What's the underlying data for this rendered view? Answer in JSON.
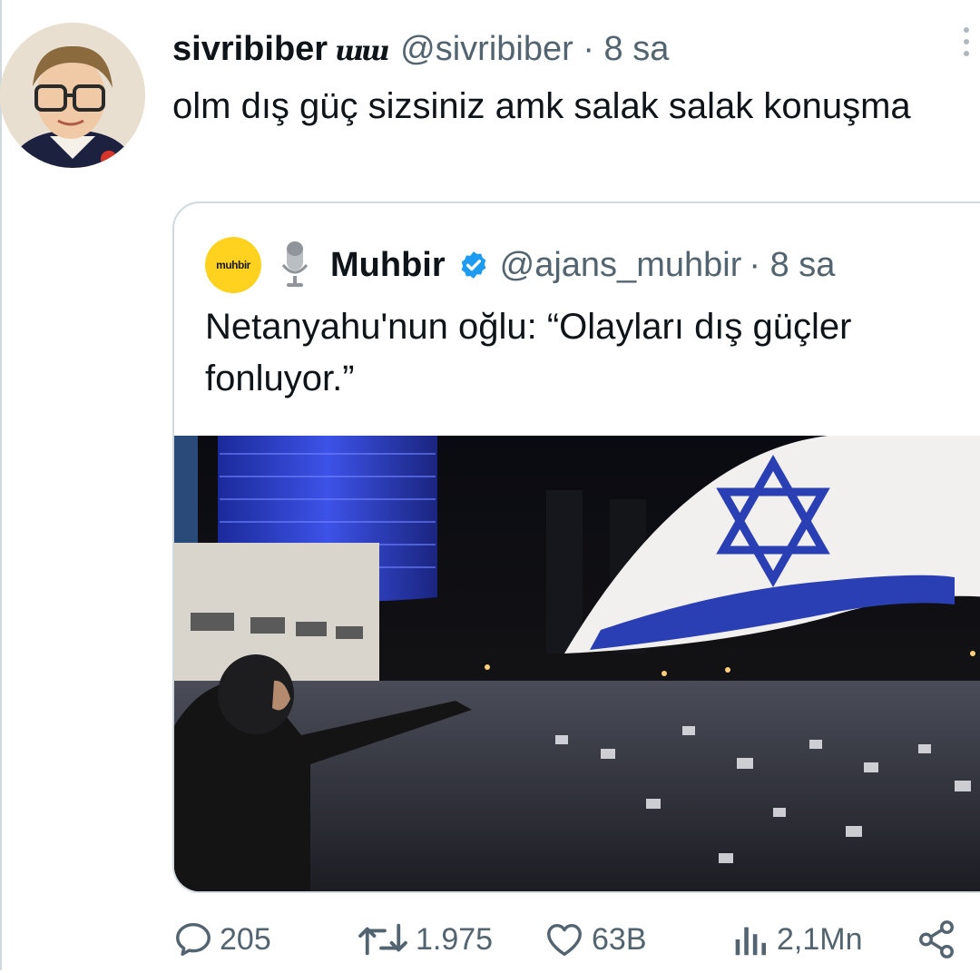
{
  "tweet": {
    "display_name": "sivribiber",
    "name_glyph": "ɯɯ",
    "handle": "@sivribiber",
    "time": "· 8 sa",
    "text": "olm dış güç sizsiniz amk salak salak konuşma"
  },
  "quoted_tweet": {
    "avatar_text": "muhbir",
    "display_name": "Muhbir",
    "handle": "@ajans_muhbir",
    "time": "· 8 sa",
    "text": "Netanyahu'nun oğlu: “Olayları dış güçler fonluyor.”"
  },
  "actions": {
    "replies": "205",
    "retweets": "1.975",
    "likes": "63B",
    "views": "2,1Mn"
  },
  "colors": {
    "verified": "#1d9bf0",
    "muted_text": "#536471",
    "border": "#cfd9de",
    "flag_blue": "#2b3fb4"
  }
}
